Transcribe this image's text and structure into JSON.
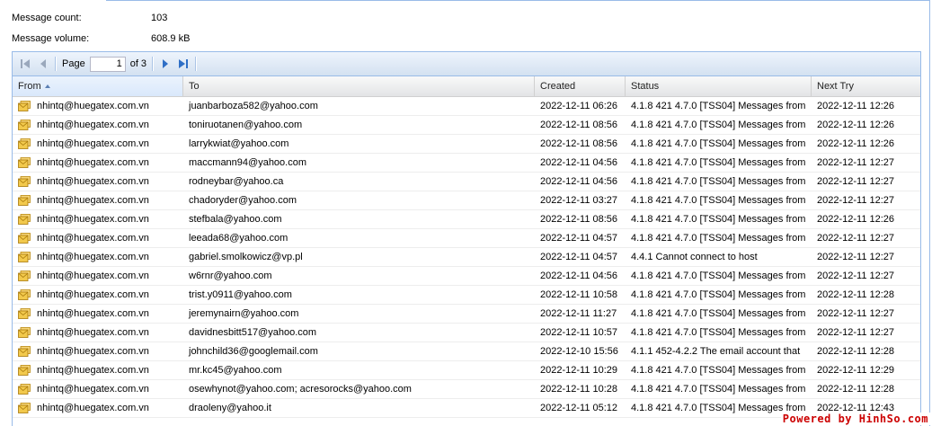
{
  "summary": {
    "message_count_label": "Message count:",
    "message_count_value": "103",
    "message_volume_label": "Message volume:",
    "message_volume_value": "608.9 kB"
  },
  "pager": {
    "page_label": "Page",
    "page_value": "1",
    "of_label": "of 3"
  },
  "columns": {
    "from": "From",
    "to": "To",
    "created": "Created",
    "status": "Status",
    "next_try": "Next Try"
  },
  "sort": {
    "column": "from",
    "direction": "asc"
  },
  "rows": [
    {
      "from": "nhintq@huegatex.com.vn",
      "to": "juanbarboza582@yahoo.com",
      "created": "2022-12-11 06:26",
      "status": "4.1.8 421 4.7.0 [TSS04] Messages from",
      "next_try": "2022-12-11 12:26"
    },
    {
      "from": "nhintq@huegatex.com.vn",
      "to": "toniruotanen@yahoo.com",
      "created": "2022-12-11 08:56",
      "status": "4.1.8 421 4.7.0 [TSS04] Messages from",
      "next_try": "2022-12-11 12:26"
    },
    {
      "from": "nhintq@huegatex.com.vn",
      "to": "larrykwiat@yahoo.com",
      "created": "2022-12-11 08:56",
      "status": "4.1.8 421 4.7.0 [TSS04] Messages from",
      "next_try": "2022-12-11 12:26"
    },
    {
      "from": "nhintq@huegatex.com.vn",
      "to": "maccmann94@yahoo.com",
      "created": "2022-12-11 04:56",
      "status": "4.1.8 421 4.7.0 [TSS04] Messages from",
      "next_try": "2022-12-11 12:27"
    },
    {
      "from": "nhintq@huegatex.com.vn",
      "to": "rodneybar@yahoo.ca",
      "created": "2022-12-11 04:56",
      "status": "4.1.8 421 4.7.0 [TSS04] Messages from",
      "next_try": "2022-12-11 12:27"
    },
    {
      "from": "nhintq@huegatex.com.vn",
      "to": "chadoryder@yahoo.com",
      "created": "2022-12-11 03:27",
      "status": "4.1.8 421 4.7.0 [TSS04] Messages from",
      "next_try": "2022-12-11 12:27"
    },
    {
      "from": "nhintq@huegatex.com.vn",
      "to": "stefbala@yahoo.com",
      "created": "2022-12-11 08:56",
      "status": "4.1.8 421 4.7.0 [TSS04] Messages from",
      "next_try": "2022-12-11 12:26"
    },
    {
      "from": "nhintq@huegatex.com.vn",
      "to": "leeada68@yahoo.com",
      "created": "2022-12-11 04:57",
      "status": "4.1.8 421 4.7.0 [TSS04] Messages from",
      "next_try": "2022-12-11 12:27"
    },
    {
      "from": "nhintq@huegatex.com.vn",
      "to": "gabriel.smolkowicz@vp.pl",
      "created": "2022-12-11 04:57",
      "status": "4.4.1 Cannot connect to host",
      "next_try": "2022-12-11 12:27"
    },
    {
      "from": "nhintq@huegatex.com.vn",
      "to": "w6rnr@yahoo.com",
      "created": "2022-12-11 04:56",
      "status": "4.1.8 421 4.7.0 [TSS04] Messages from",
      "next_try": "2022-12-11 12:27"
    },
    {
      "from": "nhintq@huegatex.com.vn",
      "to": "trist.y0911@yahoo.com",
      "created": "2022-12-11 10:58",
      "status": "4.1.8 421 4.7.0 [TSS04] Messages from",
      "next_try": "2022-12-11 12:28"
    },
    {
      "from": "nhintq@huegatex.com.vn",
      "to": "jeremynairn@yahoo.com",
      "created": "2022-12-11 11:27",
      "status": "4.1.8 421 4.7.0 [TSS04] Messages from",
      "next_try": "2022-12-11 12:27"
    },
    {
      "from": "nhintq@huegatex.com.vn",
      "to": "davidnesbitt517@yahoo.com",
      "created": "2022-12-11 10:57",
      "status": "4.1.8 421 4.7.0 [TSS04] Messages from",
      "next_try": "2022-12-11 12:27"
    },
    {
      "from": "nhintq@huegatex.com.vn",
      "to": "johnchild36@googlemail.com",
      "created": "2022-12-10 15:56",
      "status": "4.1.1 452-4.2.2 The email account that",
      "next_try": "2022-12-11 12:28"
    },
    {
      "from": "nhintq@huegatex.com.vn",
      "to": "mr.kc45@yahoo.com",
      "created": "2022-12-11 10:29",
      "status": "4.1.8 421 4.7.0 [TSS04] Messages from",
      "next_try": "2022-12-11 12:29"
    },
    {
      "from": "nhintq@huegatex.com.vn",
      "to": "osewhynot@yahoo.com; acresorocks@yahoo.com",
      "created": "2022-12-11 10:28",
      "status": "4.1.8 421 4.7.0 [TSS04] Messages from",
      "next_try": "2022-12-11 12:28"
    },
    {
      "from": "nhintq@huegatex.com.vn",
      "to": "draoleny@yahoo.it",
      "created": "2022-12-11 05:12",
      "status": "4.1.8 421 4.7.0 [TSS04] Messages from",
      "next_try": "2022-12-11 12:43"
    }
  ],
  "watermark": "Powered by HinhSo.com",
  "colors": {
    "accent": "#99bbe8",
    "watermark": "#cc0000",
    "icon_yellow": "#f2c94c"
  }
}
